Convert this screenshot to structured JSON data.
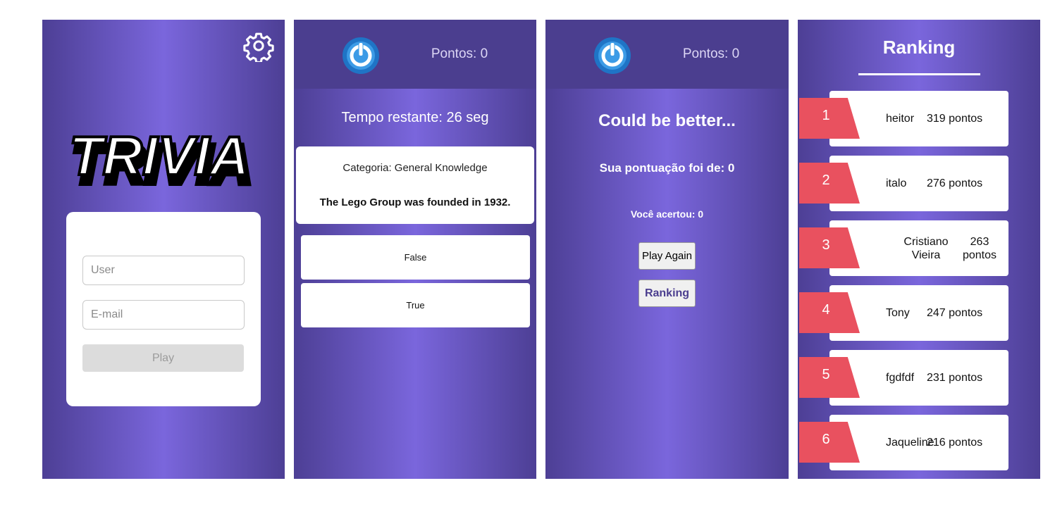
{
  "login": {
    "logo_text": "TRIVIA",
    "user_placeholder": "User",
    "email_placeholder": "E-mail",
    "play_label": "Play",
    "settings_icon": "gear-icon"
  },
  "game": {
    "score_label": "Pontos: 0",
    "timer_label": "Tempo restante: 26 seg",
    "category_label": "Categoria: General Knowledge",
    "question_text": "The Lego Group was founded in 1932.",
    "answers": [
      "False",
      "True"
    ],
    "avatar_icon": "power-icon"
  },
  "feedback": {
    "score_label": "Pontos: 0",
    "title": "Could be better...",
    "score_text": "Sua pontuação foi de: 0",
    "hits_text": "Você acertou: 0",
    "play_again_label": "Play Again",
    "ranking_label": "Ranking"
  },
  "ranking": {
    "title": "Ranking",
    "rows": [
      {
        "rank": "1",
        "name": "heitor",
        "points": "319 pontos"
      },
      {
        "rank": "2",
        "name": "italo",
        "points": "276 pontos"
      },
      {
        "rank": "3",
        "name": "Cristiano Vieira",
        "points": "263 pontos"
      },
      {
        "rank": "4",
        "name": "Tony",
        "points": "247 pontos"
      },
      {
        "rank": "5",
        "name": "fgdfdf",
        "points": "231 pontos"
      },
      {
        "rank": "6",
        "name": "Jaqueline",
        "points": "216 pontos"
      }
    ]
  },
  "colors": {
    "panel_dark": "#4d3f95",
    "panel_light": "#7a66dc",
    "header": "#4b3e8f",
    "rank_badge": "#e9515f",
    "power_icon_blue": "#1f74c6"
  }
}
